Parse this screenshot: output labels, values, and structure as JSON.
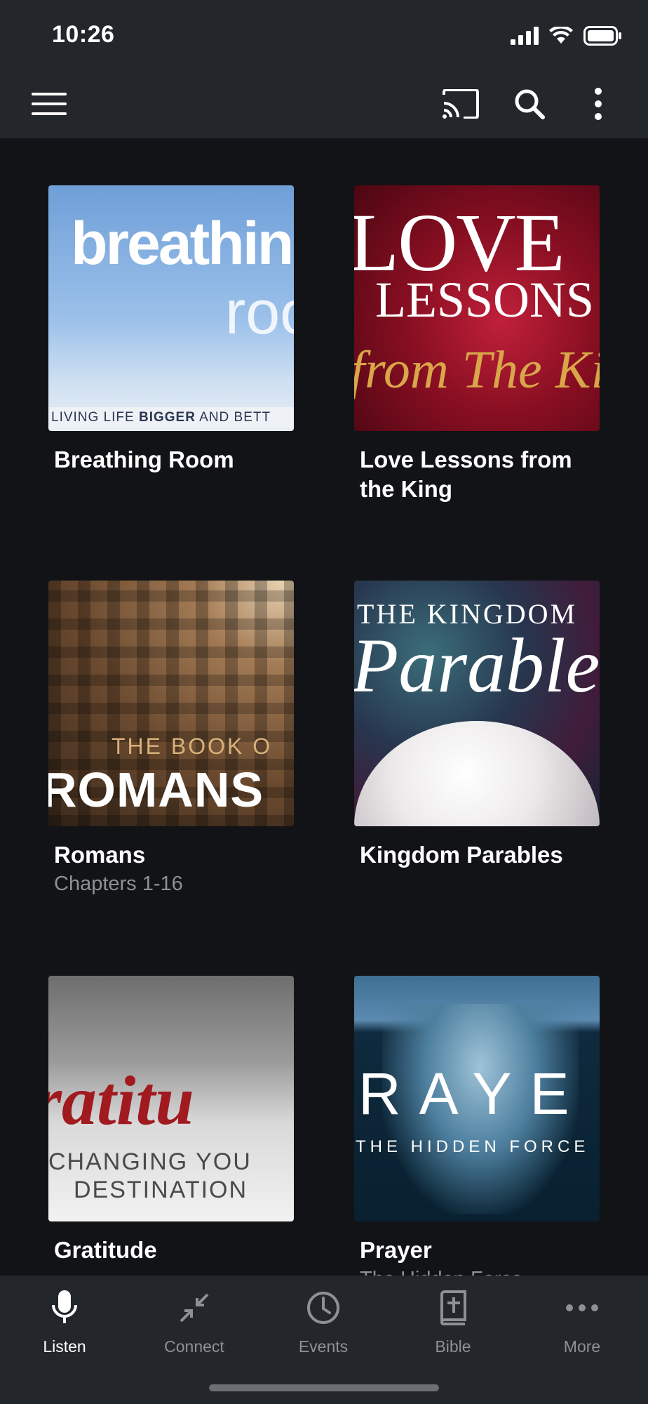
{
  "status_bar": {
    "time": "10:26",
    "icons": [
      "cellular-signal-icon",
      "wifi-icon",
      "battery-icon"
    ]
  },
  "app_bar": {
    "icons": [
      "menu-icon",
      "cast-icon",
      "search-icon",
      "more-vertical-icon"
    ]
  },
  "series": [
    {
      "title": "Breathing Room",
      "subtitle": "",
      "art": {
        "line1": "breathin",
        "line2": "roo",
        "tag_pre": "LIVING LIFE ",
        "tag_bold": "BIGGER",
        "tag_post": " AND BETT"
      }
    },
    {
      "title": "Love Lessons from the King",
      "subtitle": "",
      "art": {
        "line1": "LOVE",
        "line2": "LESSONS",
        "line3": "from The Ki"
      }
    },
    {
      "title": "Romans",
      "subtitle": "Chapters 1-16",
      "art": {
        "line1": "THE BOOK O",
        "line2": "ROMANS"
      }
    },
    {
      "title": "Kingdom Parables",
      "subtitle": "",
      "art": {
        "line1": "THE KINGDOM",
        "line2": "Parable"
      }
    },
    {
      "title": "Gratitude",
      "subtitle": "",
      "art": {
        "line1": "ratitu",
        "line2": "CHANGING YOU",
        "line3": "DESTINATION"
      }
    },
    {
      "title": "Prayer",
      "subtitle": "The Hidden Force",
      "art": {
        "line1": "RAYE",
        "line2": "THE HIDDEN FORCE"
      }
    }
  ],
  "tabs": [
    {
      "label": "Listen",
      "icon": "microphone-icon",
      "active": true
    },
    {
      "label": "Connect",
      "icon": "collapse-arrows-icon",
      "active": false
    },
    {
      "label": "Events",
      "icon": "clock-icon",
      "active": false
    },
    {
      "label": "Bible",
      "icon": "bible-icon",
      "active": false
    },
    {
      "label": "More",
      "icon": "more-horizontal-icon",
      "active": false
    }
  ],
  "colors": {
    "background": "#121316",
    "bar_background": "#23262b",
    "text_primary": "#ffffff",
    "text_secondary": "#8e9095"
  }
}
